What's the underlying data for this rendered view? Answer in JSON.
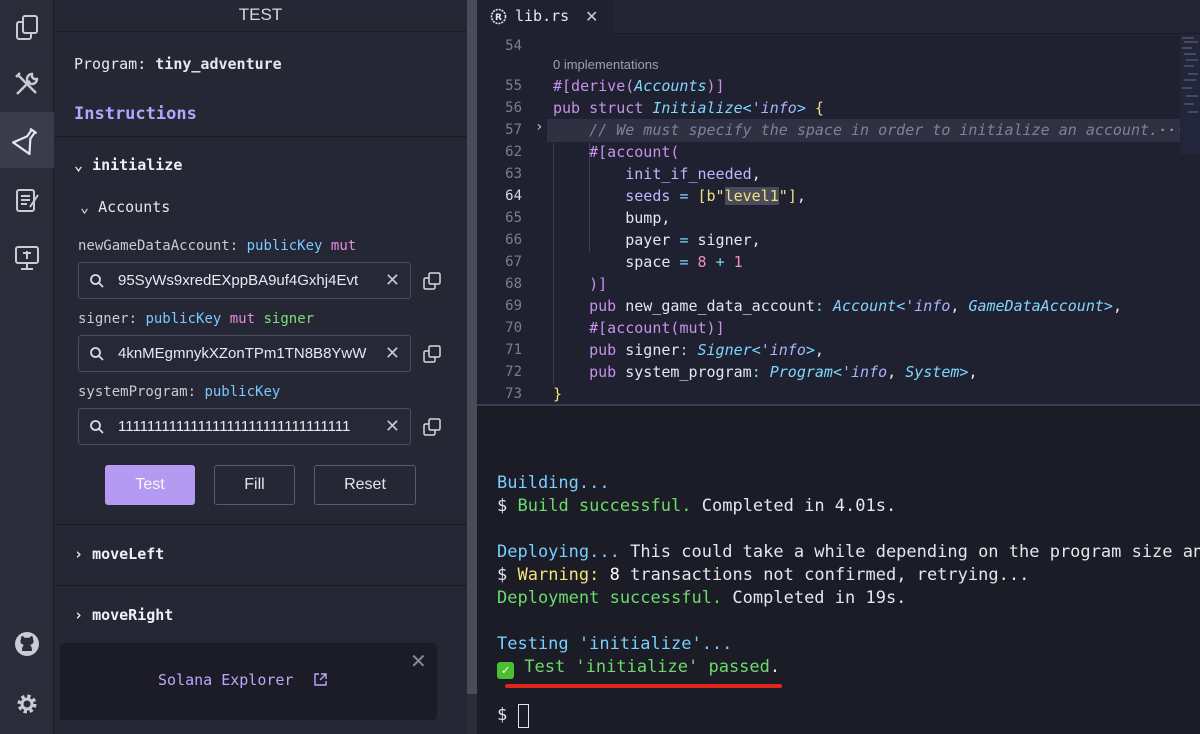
{
  "activity_bar": {
    "items": [
      {
        "icon": "explorer-icon"
      },
      {
        "icon": "build-tools-icon"
      },
      {
        "icon": "test-flask-icon",
        "active": true
      },
      {
        "icon": "notes-icon"
      },
      {
        "icon": "deploy-monitor-icon"
      },
      {
        "icon": "github-icon"
      },
      {
        "icon": "gear-icon"
      }
    ]
  },
  "sidebar": {
    "title": "TEST",
    "program_label": "Program:",
    "program_name": "tiny_adventure",
    "instructions_heading": "Instructions",
    "instruction_initialize": "initialize",
    "accounts_label": "Accounts",
    "accounts": [
      {
        "name": "newGameDataAccount:",
        "type": "publicKey",
        "mut": "mut",
        "value": "95SyWs9xredEXppBA9uf4Gxhj4Evt"
      },
      {
        "name": "signer:",
        "type": "publicKey",
        "mut": "mut",
        "signer": "signer",
        "value": "4knMEgmnykXZonTPm1TN8B8YwW"
      },
      {
        "name": "systemProgram:",
        "type": "publicKey",
        "value": "11111111111111111111111111111111"
      }
    ],
    "buttons": {
      "test": "Test",
      "fill": "Fill",
      "reset": "Reset"
    },
    "instruction_moveLeft": "moveLeft",
    "instruction_moveRight": "moveRight",
    "toast": {
      "link": "Solana Explorer",
      "close": "✕"
    }
  },
  "editor": {
    "tab_name": "lib.rs",
    "tab_close": "✕",
    "codelens": "0 implementations",
    "line_numbers": [
      "54",
      "55",
      "56",
      "57",
      "62",
      "63",
      "64",
      "65",
      "66",
      "67",
      "68",
      "69",
      "70",
      "71",
      "72",
      "73"
    ],
    "current_line": "64"
  },
  "terminal": {
    "building": "Building...",
    "prompt": "$",
    "build_ok": "Build successful.",
    "build_time": "Completed in 4.01s.",
    "deploying": "Deploying...",
    "deploying_note": "This could take a while depending on the program size an",
    "warning_label": "Warning:",
    "warning_count": "8",
    "warning_text": "transactions not confirmed, retrying...",
    "deploy_ok": "Deployment successful.",
    "deploy_time": "Completed in 19s.",
    "testing": "Testing 'initialize'...",
    "test_passed": "Test 'initialize' passed",
    "check": "✓"
  }
}
